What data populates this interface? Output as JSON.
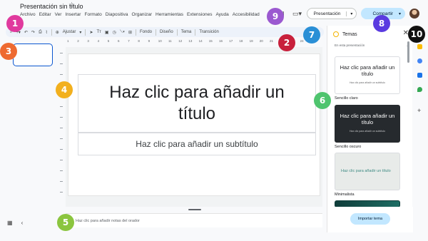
{
  "document": {
    "title": "Presentación sin título"
  },
  "menubar": [
    "Archivo",
    "Editar",
    "Ver",
    "Insertar",
    "Formato",
    "Diapositiva",
    "Organizar",
    "Herramientas",
    "Extensiones",
    "Ayuda",
    "Accesibilidad"
  ],
  "header": {
    "present_label": "Presentación",
    "share_label": "Compartir"
  },
  "toolbar": {
    "fit_label": "Ajustar",
    "fondo_label": "Fondo",
    "diseno_label": "Diseño",
    "tema_label": "Tema",
    "transicion_label": "Transición"
  },
  "slide": {
    "title_placeholder": "Haz clic para añadir un título",
    "subtitle_placeholder": "Haz clic para añadir un subtítulo"
  },
  "notes": {
    "placeholder": "Haz clic para añadir notas del orador"
  },
  "themes": {
    "panel_title": "Temas",
    "section_label": "En esta presentación",
    "items": [
      {
        "name": "Sencillo claro",
        "preview_title": "Haz clic para añadir un título",
        "preview_sub": "Haz clic para añadir un subtítulo"
      },
      {
        "name": "Sencillo oscuro",
        "preview_title": "Haz clic para añadir un título",
        "preview_sub": "Haz clic para añadir un subtítulo"
      },
      {
        "name": "Minimalista",
        "preview_title": "Haz clic para añadir un título",
        "preview_sub": ""
      }
    ],
    "import_label": "Importar tema"
  },
  "ruler_ticks": [
    "1",
    "2",
    "3",
    "4",
    "5",
    "6",
    "7",
    "8",
    "9",
    "10",
    "11",
    "12",
    "13",
    "14",
    "15",
    "16",
    "17",
    "18",
    "19",
    "20",
    "21",
    "22",
    "23",
    "24",
    "25"
  ],
  "callouts": [
    {
      "label": "1",
      "color": "#e03a9e"
    },
    {
      "label": "2",
      "color": "#c8203c"
    },
    {
      "label": "3",
      "color": "#ee6a31"
    },
    {
      "label": "4",
      "color": "#f2b01e"
    },
    {
      "label": "5",
      "color": "#8bc53f"
    },
    {
      "label": "6",
      "color": "#4fc46e"
    },
    {
      "label": "7",
      "color": "#2a8fd6"
    },
    {
      "label": "8",
      "color": "#5a3be0"
    },
    {
      "label": "9",
      "color": "#9b59d0"
    },
    {
      "label": "10",
      "color": "#111111"
    }
  ]
}
